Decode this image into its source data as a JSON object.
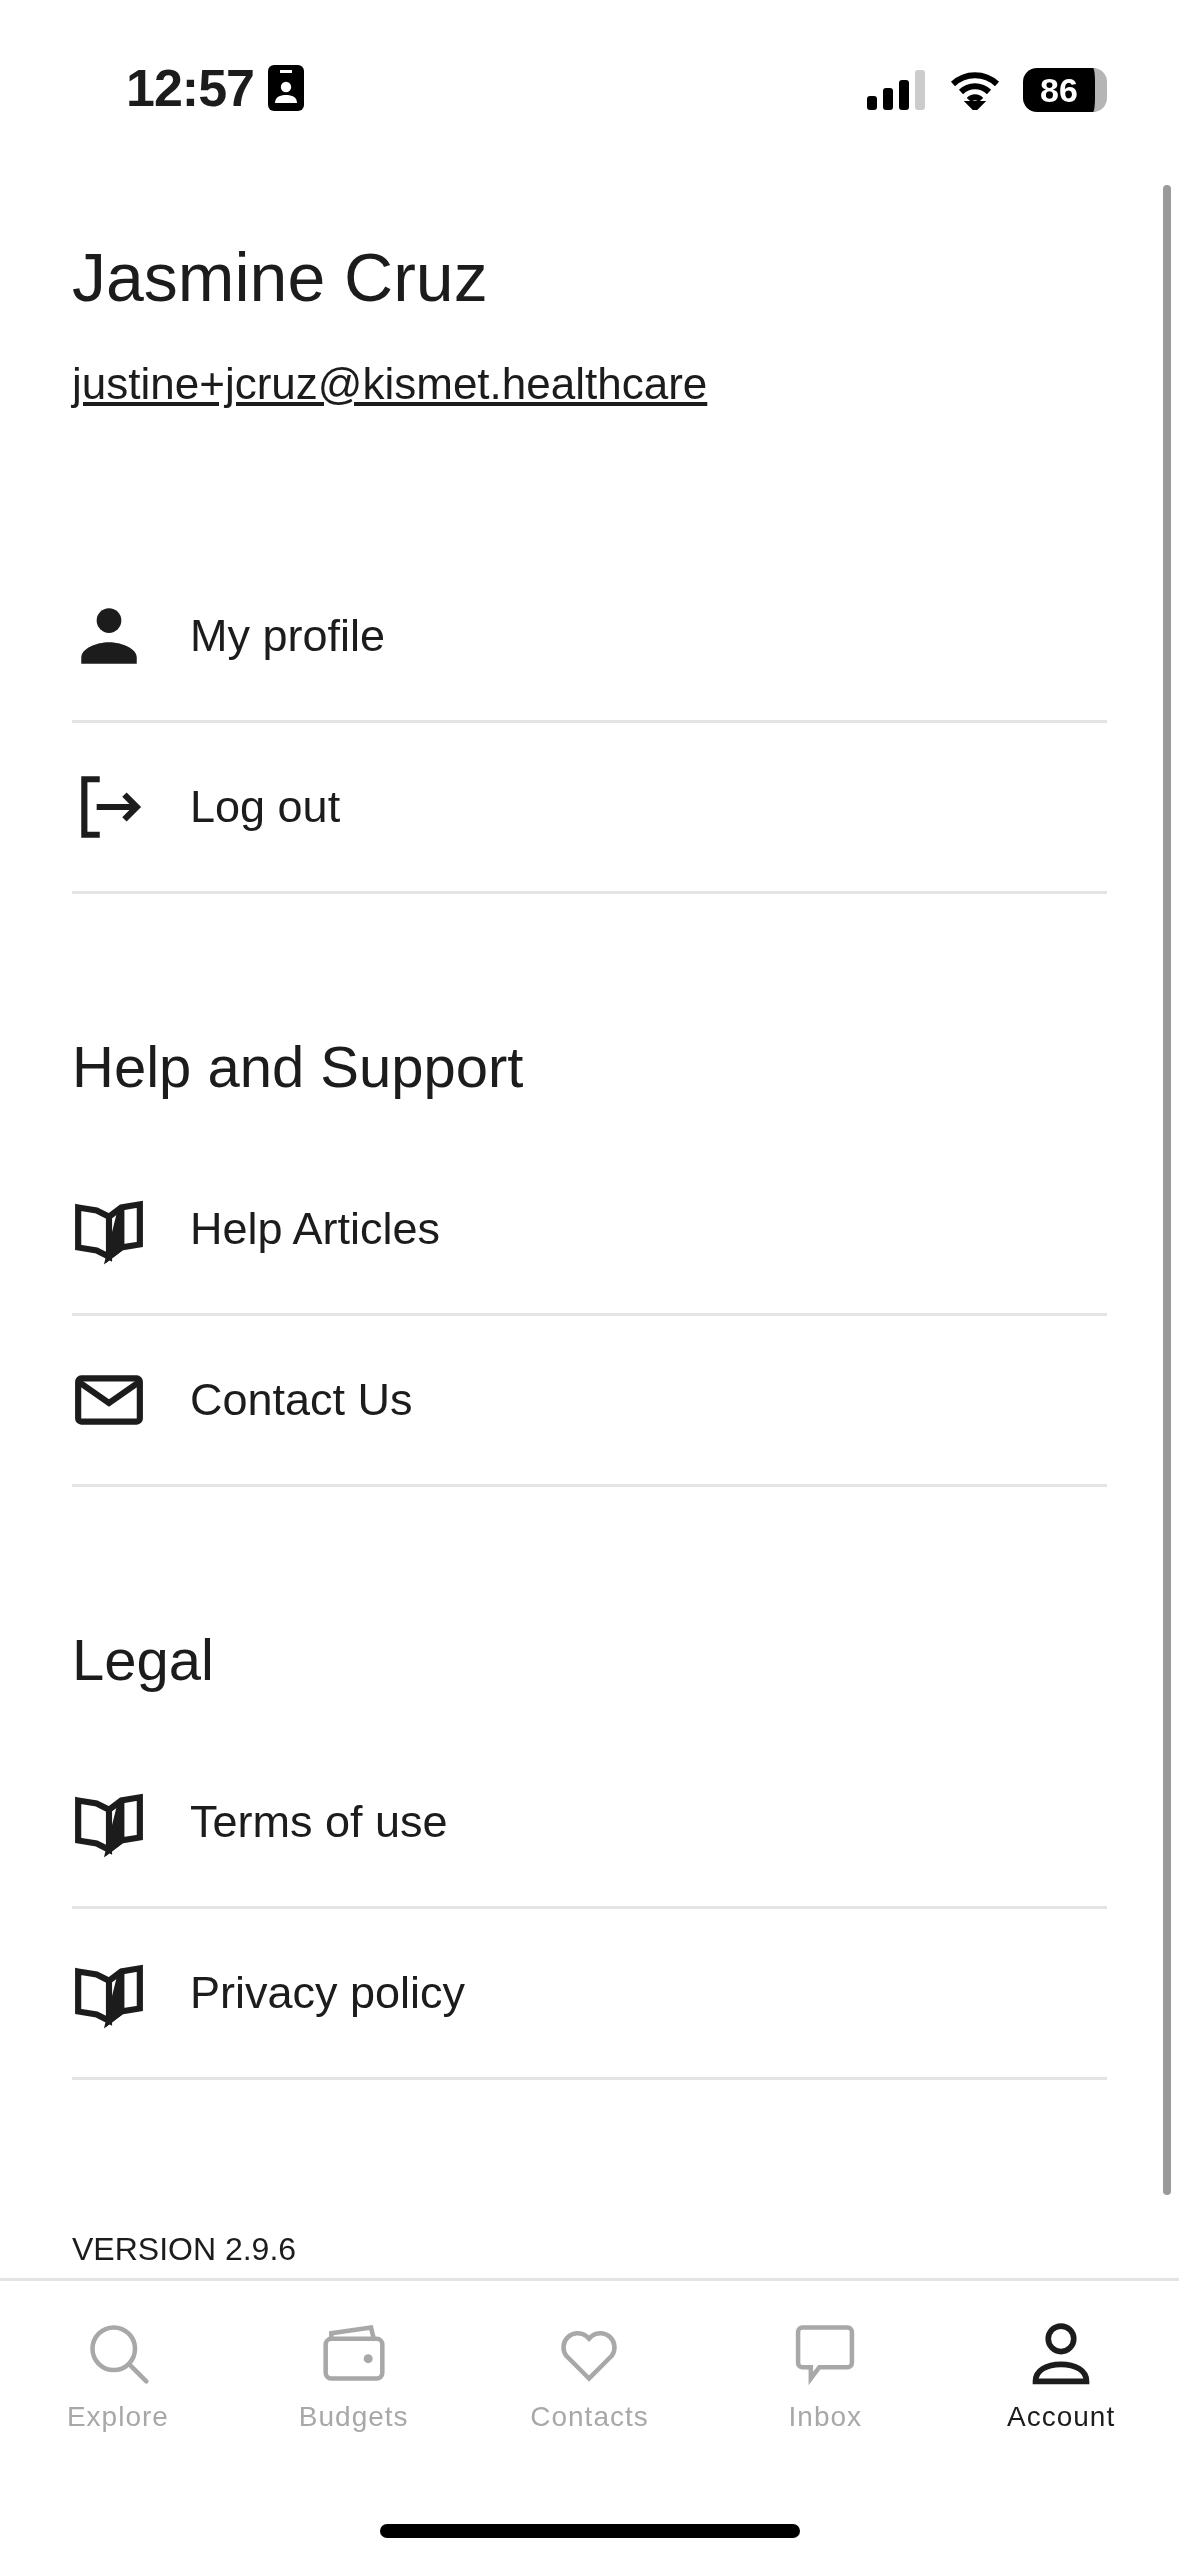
{
  "status_bar": {
    "time": "12:57",
    "battery": "86"
  },
  "profile": {
    "name": "Jasmine Cruz",
    "email": "justine+jcruz@kismet.healthcare"
  },
  "sections": [
    {
      "items": [
        {
          "kind": "person",
          "label": "My profile"
        },
        {
          "kind": "logout",
          "label": "Log out"
        }
      ]
    },
    {
      "heading": "Help and Support",
      "items": [
        {
          "kind": "book",
          "label": "Help Articles"
        },
        {
          "kind": "mail",
          "label": "Contact Us"
        }
      ]
    },
    {
      "heading": "Legal",
      "items": [
        {
          "kind": "book",
          "label": "Terms of use"
        },
        {
          "kind": "book",
          "label": "Privacy policy"
        }
      ]
    }
  ],
  "version": "VERSION 2.9.6",
  "tabs": [
    {
      "kind": "search",
      "label": "Explore",
      "selected": false
    },
    {
      "kind": "wallet",
      "label": "Budgets",
      "selected": false
    },
    {
      "kind": "heart",
      "label": "Contacts",
      "selected": false
    },
    {
      "kind": "chat",
      "label": "Inbox",
      "selected": false
    },
    {
      "kind": "person",
      "label": "Account",
      "selected": true
    }
  ]
}
